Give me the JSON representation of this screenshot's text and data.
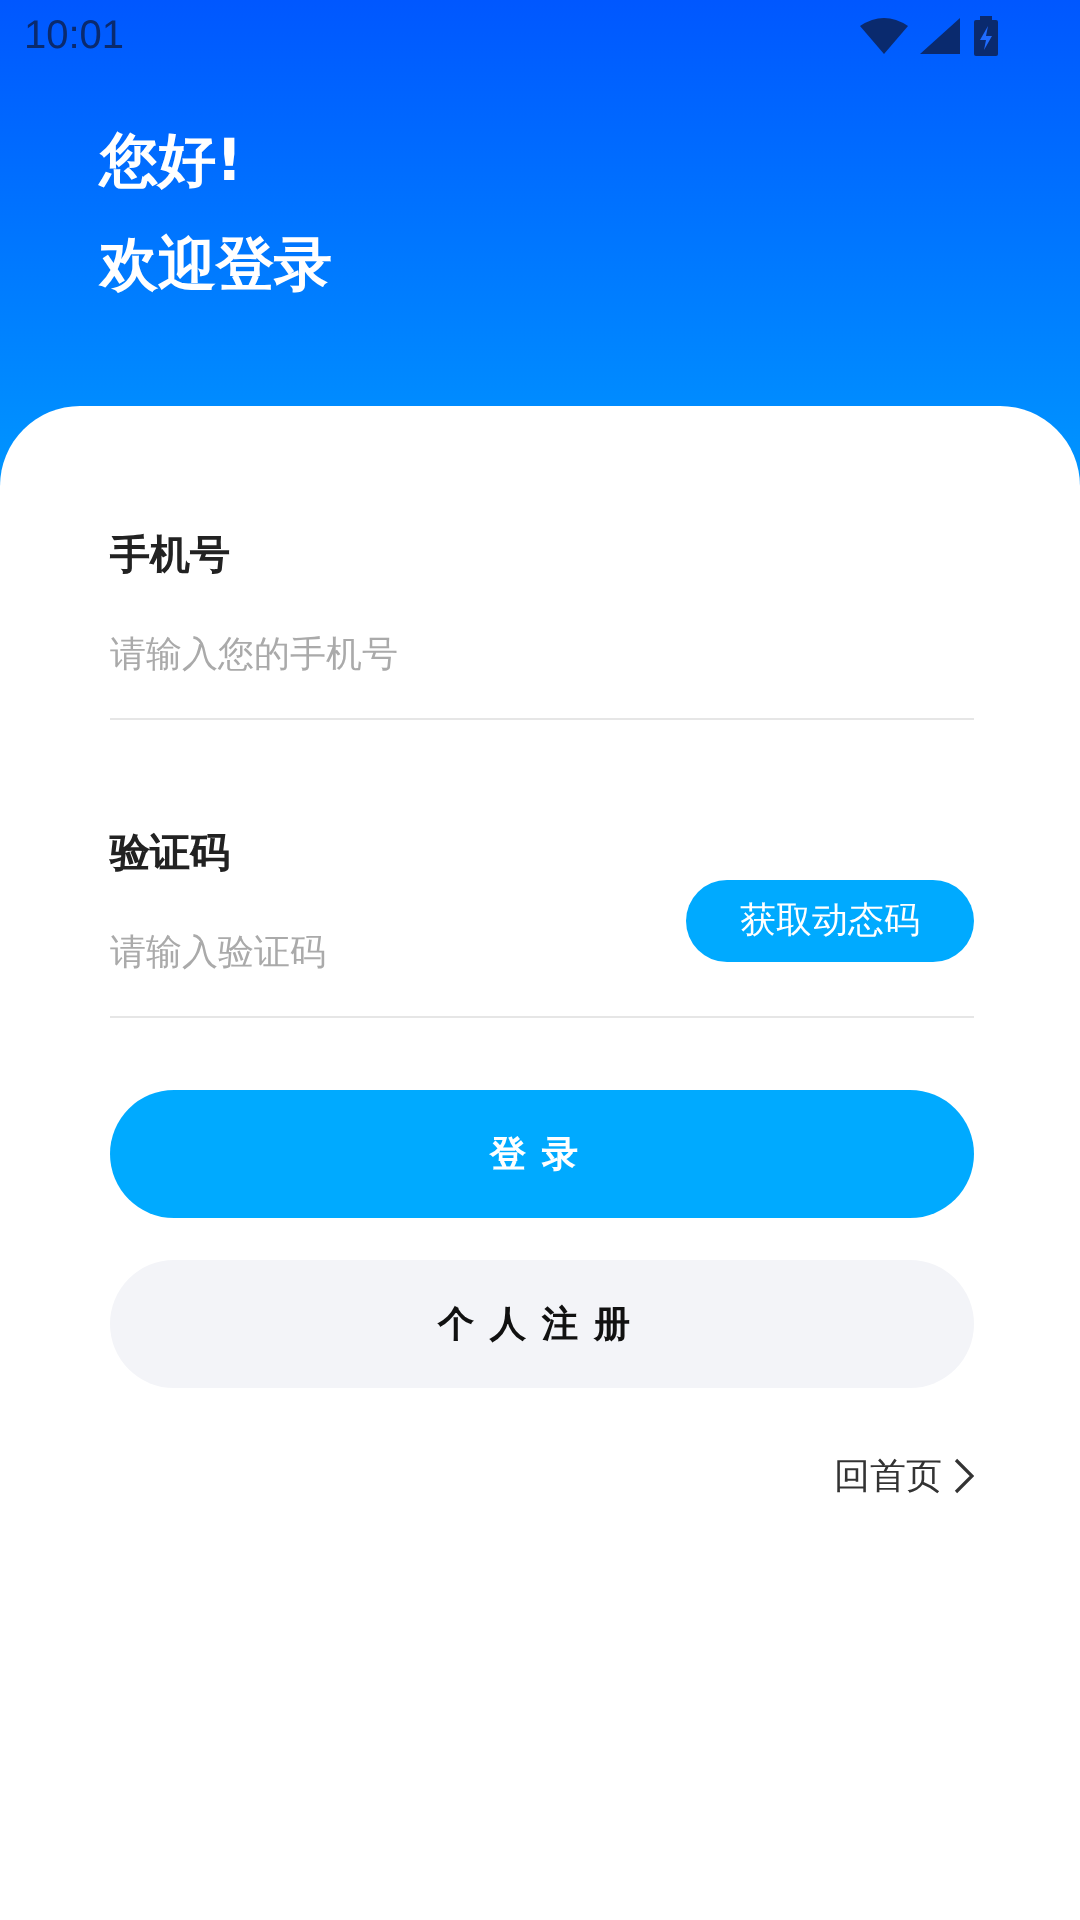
{
  "status_bar": {
    "time": "10:01"
  },
  "header": {
    "greeting": "您好!",
    "title": "欢迎登录"
  },
  "fields": [
    {
      "label": "手机号",
      "placeholder": "请输入您的手机号"
    },
    {
      "label": "验证码",
      "placeholder": "请输入验证码",
      "action": "获取动态码"
    }
  ],
  "buttons": [
    {
      "label": "登录",
      "kind": "primary"
    },
    {
      "label": "个人注册",
      "kind": "secondary"
    }
  ],
  "home_link": "回首页"
}
